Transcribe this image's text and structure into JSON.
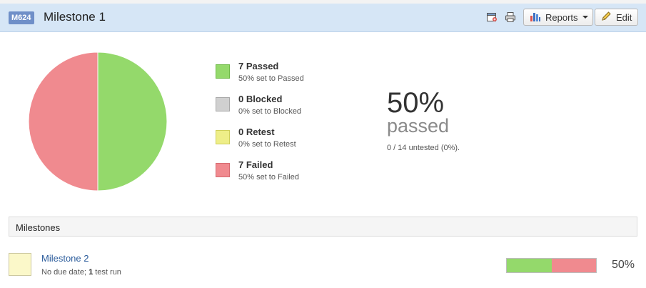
{
  "header": {
    "badge": "M624",
    "title": "Milestone 1",
    "icons": [
      "export-icon",
      "print-icon"
    ],
    "reports_label": "Reports",
    "edit_label": "Edit"
  },
  "chart_data": {
    "type": "pie",
    "categories": [
      "Passed",
      "Blocked",
      "Retest",
      "Failed"
    ],
    "values": [
      7,
      0,
      0,
      7
    ],
    "colors": [
      "#94d96b",
      "#d0d0d0",
      "#eeee88",
      "#f08a8f"
    ]
  },
  "legend": [
    {
      "title": "7 Passed",
      "sub": "50% set to Passed",
      "color": "#94d96b",
      "border": "#6fba48"
    },
    {
      "title": "0 Blocked",
      "sub": "0% set to Blocked",
      "color": "#d0d0d0",
      "border": "#a9a9a9"
    },
    {
      "title": "0 Retest",
      "sub": "0% set to Retest",
      "color": "#eeee88",
      "border": "#cfcf5a"
    },
    {
      "title": "7 Failed",
      "sub": "50% set to Failed",
      "color": "#f08a8f",
      "border": "#d66a70"
    }
  ],
  "summary": {
    "percent": "50%",
    "word": "passed",
    "untested": "0 / 14 untested (0%)."
  },
  "milestones_section": {
    "title": "Milestones",
    "items": [
      {
        "name": "Milestone 2",
        "due": "No due date; ",
        "runs_count": "1",
        "runs_label": " test run",
        "passed_fraction": 0.5,
        "failed_fraction": 0.5,
        "percent": "50%"
      }
    ]
  }
}
